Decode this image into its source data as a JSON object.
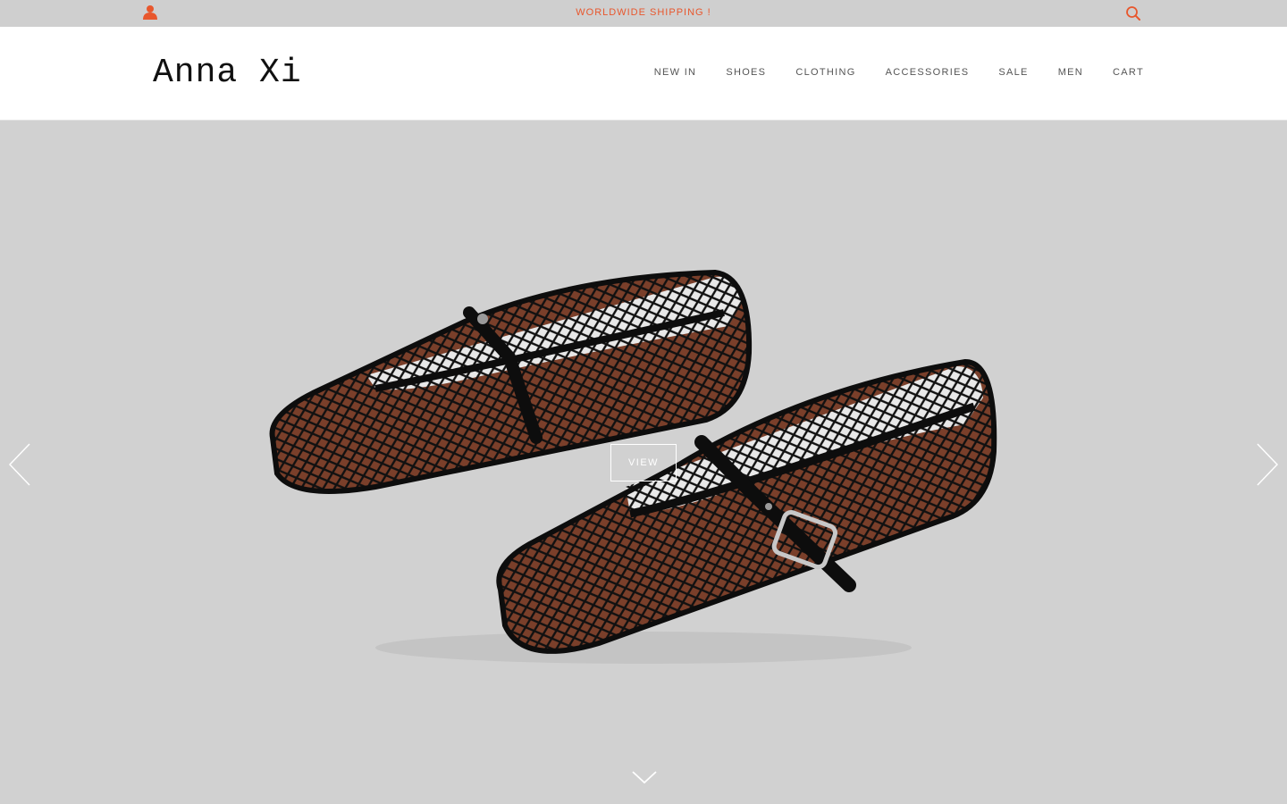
{
  "topbar": {
    "shipping_text": "WORLDWIDE SHIPPING !",
    "account_icon": "user-icon",
    "search_icon": "search-icon",
    "accent_color": "#e8572d"
  },
  "header": {
    "logo": "Anna Xi",
    "nav": [
      {
        "label": "NEW IN"
      },
      {
        "label": "SHOES"
      },
      {
        "label": "CLOTHING"
      },
      {
        "label": "ACCESSORIES"
      },
      {
        "label": "SALE"
      },
      {
        "label": "MEN"
      },
      {
        "label": "CART"
      }
    ]
  },
  "hero": {
    "view_label": "VIEW",
    "prev_icon": "chevron-left-icon",
    "next_icon": "chevron-right-icon",
    "scroll_icon": "chevron-down-icon",
    "image": "black mesh mary-jane ballet flats with patent straps and silver buckle"
  }
}
